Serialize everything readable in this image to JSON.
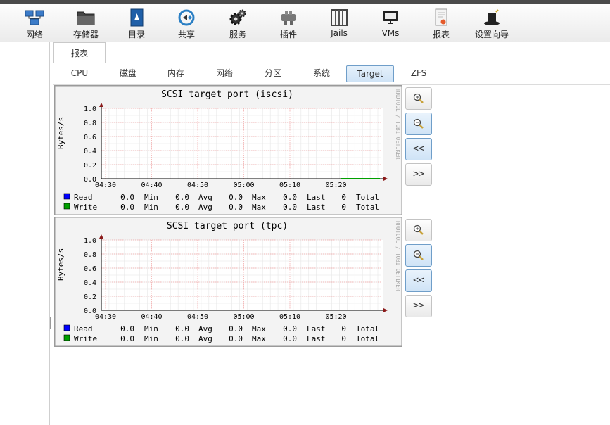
{
  "toolbar": {
    "items": [
      {
        "label": "网络",
        "icon": "network-icon"
      },
      {
        "label": "存储器",
        "icon": "folder-icon"
      },
      {
        "label": "目录",
        "icon": "book-icon"
      },
      {
        "label": "共享",
        "icon": "share-icon"
      },
      {
        "label": "服务",
        "icon": "gears-icon"
      },
      {
        "label": "插件",
        "icon": "plugin-icon"
      },
      {
        "label": "Jails",
        "icon": "jails-icon"
      },
      {
        "label": "VMs",
        "icon": "monitor-icon"
      },
      {
        "label": "报表",
        "icon": "report-icon"
      },
      {
        "label": "设置向导",
        "icon": "wizard-hat-icon"
      }
    ]
  },
  "main": {
    "tab": "报表",
    "subtabs": [
      "CPU",
      "磁盘",
      "内存",
      "网络",
      "分区",
      "系统",
      "Target",
      "ZFS"
    ],
    "active_subtab": "Target"
  },
  "graph_buttons": {
    "zoom_in": "zoom-in-icon",
    "zoom_out": "zoom-out-icon",
    "back": "<<",
    "forward": ">>"
  },
  "graphs": [
    {
      "title": "SCSI target port (iscsi)",
      "ylabel": "Bytes/s",
      "watermark": "RRDTOOL / TOBI OETIKER",
      "yticks": [
        "1.0",
        "0.8",
        "0.6",
        "0.4",
        "0.2",
        "0.0"
      ],
      "xticks": [
        "04:30",
        "04:40",
        "04:50",
        "05:00",
        "05:10",
        "05:20"
      ],
      "legend": [
        {
          "name": "Read",
          "color": "#0000ff",
          "min": "0.0",
          "avg": "0.0",
          "max": "0.0",
          "last": "0.0",
          "total": "0"
        },
        {
          "name": "Write",
          "color": "#00a000",
          "min": "0.0",
          "avg": "0.0",
          "max": "0.0",
          "last": "0.0",
          "total": "0"
        }
      ],
      "stat_labels": [
        "Min",
        "Avg",
        "Max",
        "Last",
        "Total"
      ]
    },
    {
      "title": "SCSI target port (tpc)",
      "ylabel": "Bytes/s",
      "watermark": "RRDTOOL / TOBI OETIKER",
      "yticks": [
        "1.0",
        "0.8",
        "0.6",
        "0.4",
        "0.2",
        "0.0"
      ],
      "xticks": [
        "04:30",
        "04:40",
        "04:50",
        "05:00",
        "05:10",
        "05:20"
      ],
      "legend": [
        {
          "name": "Read",
          "color": "#0000ff",
          "min": "0.0",
          "avg": "0.0",
          "max": "0.0",
          "last": "0.0",
          "total": "0"
        },
        {
          "name": "Write",
          "color": "#00a000",
          "min": "0.0",
          "avg": "0.0",
          "max": "0.0",
          "last": "0.0",
          "total": "0"
        }
      ],
      "stat_labels": [
        "Min",
        "Avg",
        "Max",
        "Last",
        "Total"
      ]
    }
  ]
}
